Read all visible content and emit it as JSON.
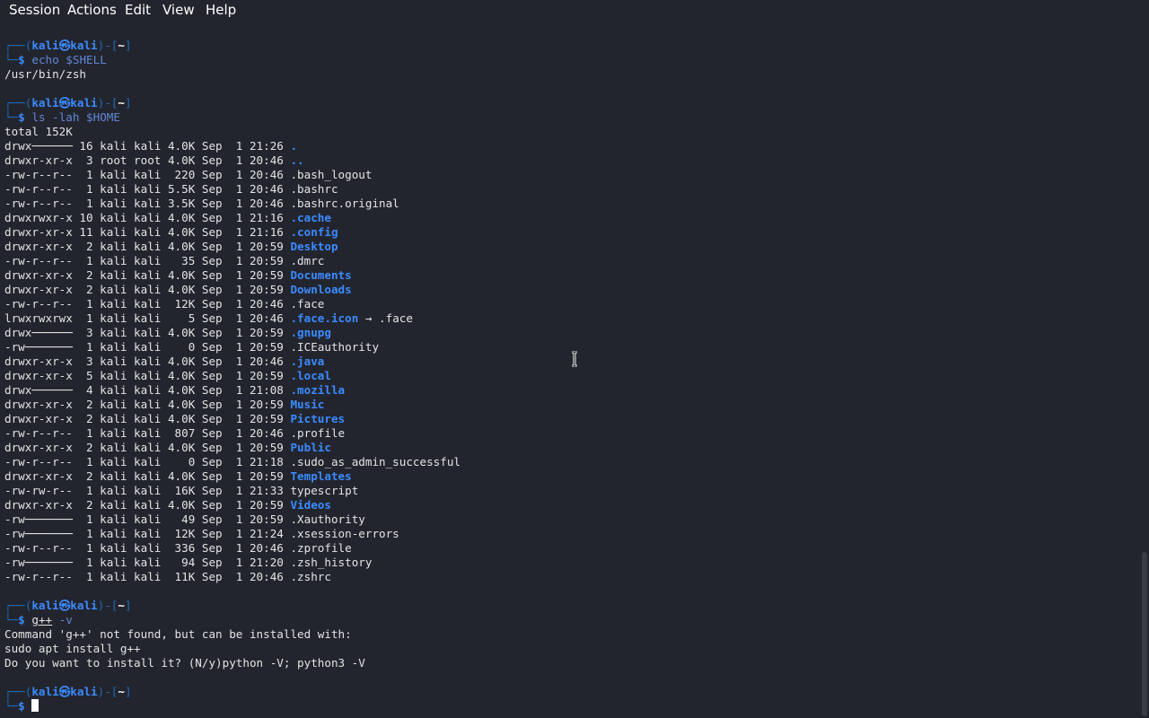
{
  "menu": {
    "items": [
      {
        "name": "menu-session",
        "label": "Session"
      },
      {
        "name": "menu-actions",
        "label": "Actions"
      },
      {
        "name": "menu-edit",
        "label": "Edit"
      },
      {
        "name": "menu-view",
        "label": "View"
      },
      {
        "name": "menu-help",
        "label": "Help"
      }
    ]
  },
  "prompt": {
    "top_prefix": "┌──(",
    "user": "kali",
    "at": "㉿",
    "host": "kali",
    "mid": ")-[",
    "path": "~",
    "end": "]",
    "bottom_prefix": "└─",
    "symbol": "$"
  },
  "entries": [
    {
      "command": "echo",
      "args": " $SHELL",
      "output": [
        "/usr/bin/zsh"
      ]
    },
    {
      "command": "ls",
      "args": " -lah $HOME",
      "output": [
        "total 152K"
      ]
    },
    {
      "command": "g++",
      "args": " -v",
      "output": [
        "Command 'g++' not found, but can be installed with:",
        "sudo apt install g++",
        "Do you want to install it? (N/y)python -V; python3 -V"
      ]
    }
  ],
  "listing": [
    {
      "meta": "drwx────── 16 kali kali 4.0K Sep  1 21:26 ",
      "name": ".",
      "dir": true
    },
    {
      "meta": "drwxr-xr-x  3 root root 4.0K Sep  1 20:46 ",
      "name": "..",
      "dir": true
    },
    {
      "meta": "-rw-r--r--  1 kali kali  220 Sep  1 20:46 ",
      "name": ".bash_logout",
      "dir": false
    },
    {
      "meta": "-rw-r--r--  1 kali kali 5.5K Sep  1 20:46 ",
      "name": ".bashrc",
      "dir": false
    },
    {
      "meta": "-rw-r--r--  1 kali kali 3.5K Sep  1 20:46 ",
      "name": ".bashrc.original",
      "dir": false
    },
    {
      "meta": "drwxrwxr-x 10 kali kali 4.0K Sep  1 21:16 ",
      "name": ".cache",
      "dir": true
    },
    {
      "meta": "drwxr-xr-x 11 kali kali 4.0K Sep  1 21:16 ",
      "name": ".config",
      "dir": true
    },
    {
      "meta": "drwxr-xr-x  2 kali kali 4.0K Sep  1 20:59 ",
      "name": "Desktop",
      "dir": true
    },
    {
      "meta": "-rw-r--r--  1 kali kali   35 Sep  1 20:59 ",
      "name": ".dmrc",
      "dir": false
    },
    {
      "meta": "drwxr-xr-x  2 kali kali 4.0K Sep  1 20:59 ",
      "name": "Documents",
      "dir": true
    },
    {
      "meta": "drwxr-xr-x  2 kali kali 4.0K Sep  1 20:59 ",
      "name": "Downloads",
      "dir": true
    },
    {
      "meta": "-rw-r--r--  1 kali kali  12K Sep  1 20:46 ",
      "name": ".face",
      "dir": false
    },
    {
      "meta": "lrwxrwxrwx  1 kali kali    5 Sep  1 20:46 ",
      "name": ".face.icon",
      "dir": true,
      "target": " → .face"
    },
    {
      "meta": "drwx──────  3 kali kali 4.0K Sep  1 20:59 ",
      "name": ".gnupg",
      "dir": true
    },
    {
      "meta": "-rw───────  1 kali kali    0 Sep  1 20:59 ",
      "name": ".ICEauthority",
      "dir": false
    },
    {
      "meta": "drwxr-xr-x  3 kali kali 4.0K Sep  1 20:46 ",
      "name": ".java",
      "dir": true
    },
    {
      "meta": "drwxr-xr-x  5 kali kali 4.0K Sep  1 20:59 ",
      "name": ".local",
      "dir": true
    },
    {
      "meta": "drwx──────  4 kali kali 4.0K Sep  1 21:08 ",
      "name": ".mozilla",
      "dir": true
    },
    {
      "meta": "drwxr-xr-x  2 kali kali 4.0K Sep  1 20:59 ",
      "name": "Music",
      "dir": true
    },
    {
      "meta": "drwxr-xr-x  2 kali kali 4.0K Sep  1 20:59 ",
      "name": "Pictures",
      "dir": true
    },
    {
      "meta": "-rw-r--r--  1 kali kali  807 Sep  1 20:46 ",
      "name": ".profile",
      "dir": false
    },
    {
      "meta": "drwxr-xr-x  2 kali kali 4.0K Sep  1 20:59 ",
      "name": "Public",
      "dir": true
    },
    {
      "meta": "-rw-r--r--  1 kali kali    0 Sep  1 21:18 ",
      "name": ".sudo_as_admin_successful",
      "dir": false
    },
    {
      "meta": "drwxr-xr-x  2 kali kali 4.0K Sep  1 20:59 ",
      "name": "Templates",
      "dir": true
    },
    {
      "meta": "-rw-rw-r--  1 kali kali  16K Sep  1 21:33 ",
      "name": "typescript",
      "dir": false
    },
    {
      "meta": "drwxr-xr-x  2 kali kali 4.0K Sep  1 20:59 ",
      "name": "Videos",
      "dir": true
    },
    {
      "meta": "-rw───────  1 kali kali   49 Sep  1 20:59 ",
      "name": ".Xauthority",
      "dir": false
    },
    {
      "meta": "-rw───────  1 kali kali  12K Sep  1 21:24 ",
      "name": ".xsession-errors",
      "dir": false
    },
    {
      "meta": "-rw-r--r--  1 kali kali  336 Sep  1 20:46 ",
      "name": ".zprofile",
      "dir": false
    },
    {
      "meta": "-rw───────  1 kali kali   94 Sep  1 21:20 ",
      "name": ".zsh_history",
      "dir": false
    },
    {
      "meta": "-rw-r--r--  1 kali kali  11K Sep  1 20:46 ",
      "name": ".zshrc",
      "dir": false
    }
  ]
}
